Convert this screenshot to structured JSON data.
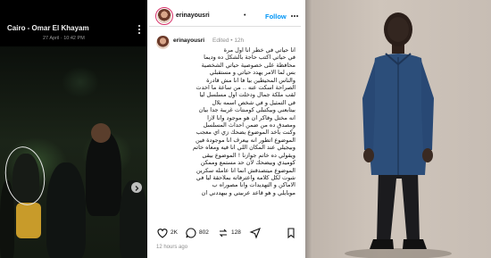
{
  "left_post": {
    "title": "Cairo - Omar El Khayam",
    "date": "27 April · 10:42 PM"
  },
  "middle_post": {
    "username": "erinayousri",
    "follow_label": "Follow",
    "separator": "•",
    "caption_username": "erinayousri",
    "edited_label": "Edited • 12h",
    "caption_lines": [
      "انا حياتي في خطر انا اول مرة",
      "في حياتي اكتب حاجة بالشكل ده وديما",
      "محافظة على خصوصية حياتي الشخصية",
      "بس لما الامر يهدد حياتي و مستقبلي",
      "والناس المحيطين بيا فا انا مش قادرة",
      "الصراحة اسكت عنه .. من ساعة ما اخدت",
      "لقب ملكة جمال ودخلت اول مسلسل ليا",
      "في التمثيل و في شخص اسمه بلال",
      "بيتابعني وبيكتبلي كومنتات غريبة جدا بيان",
      "انه مختل وفاكر ان هو موجود وانا لازا",
      "ومصدق ده من ضمن احداث المسلسل",
      "وكنت باخد الموضوع بضحك زي اي معجب",
      "الموضوع اتطور انه بيعرف انا موجودة فين",
      "وبيجيلي عند المكان اللي انا فيه ومعاه خاتم",
      "ويقولي ده خاتم جوازنا ! الموضوع بيقى",
      "كوميدي وبيضحك لأن حد مستمع وممكن",
      "الموضوع ميتصدقش انما انا عامله سكرين",
      "شوت لكل كلامه واعترفاته بملاحقة ليا في",
      "الاماكن و التهديدات وانا مصوراه ب",
      "موبايلي و هو قاعد عربيتي و بيهددني ان"
    ],
    "likes": "2K",
    "comments": "802",
    "shares": "128",
    "time_ago": "12 hours ago"
  },
  "colors": {
    "follow_blue": "#0095f6",
    "avatar_ring": "#d8336b",
    "jacket": "#2c4e7a"
  },
  "icons": [
    "more-icon",
    "next-arrow-icon",
    "heart-icon",
    "comment-icon",
    "share-icon",
    "send-icon",
    "bookmark-icon"
  ]
}
